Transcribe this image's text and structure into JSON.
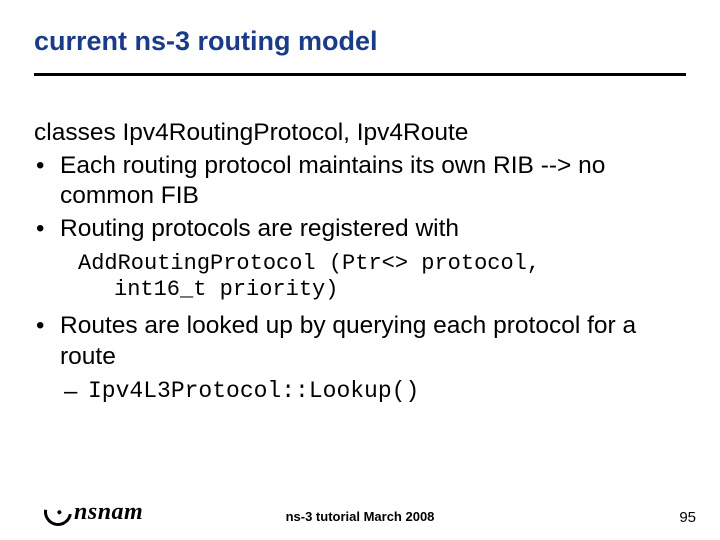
{
  "title": "current ns-3 routing model",
  "content": {
    "classes_line": "classes Ipv4RoutingProtocol, Ipv4Route",
    "bullet1": "Each routing protocol maintains its own RIB --> no common FIB",
    "bullet2": "Routing protocols are registered with",
    "code_line1": "AddRoutingProtocol (Ptr<> protocol,",
    "code_line2": "int16_t priority)",
    "bullet3": "Routes are looked up by querying each protocol for a route",
    "sub_code": "Ipv4L3Protocol::Lookup()"
  },
  "footer": {
    "logo_text": "nsnam",
    "center": "ns-3 tutorial March 2008",
    "page": "95"
  }
}
